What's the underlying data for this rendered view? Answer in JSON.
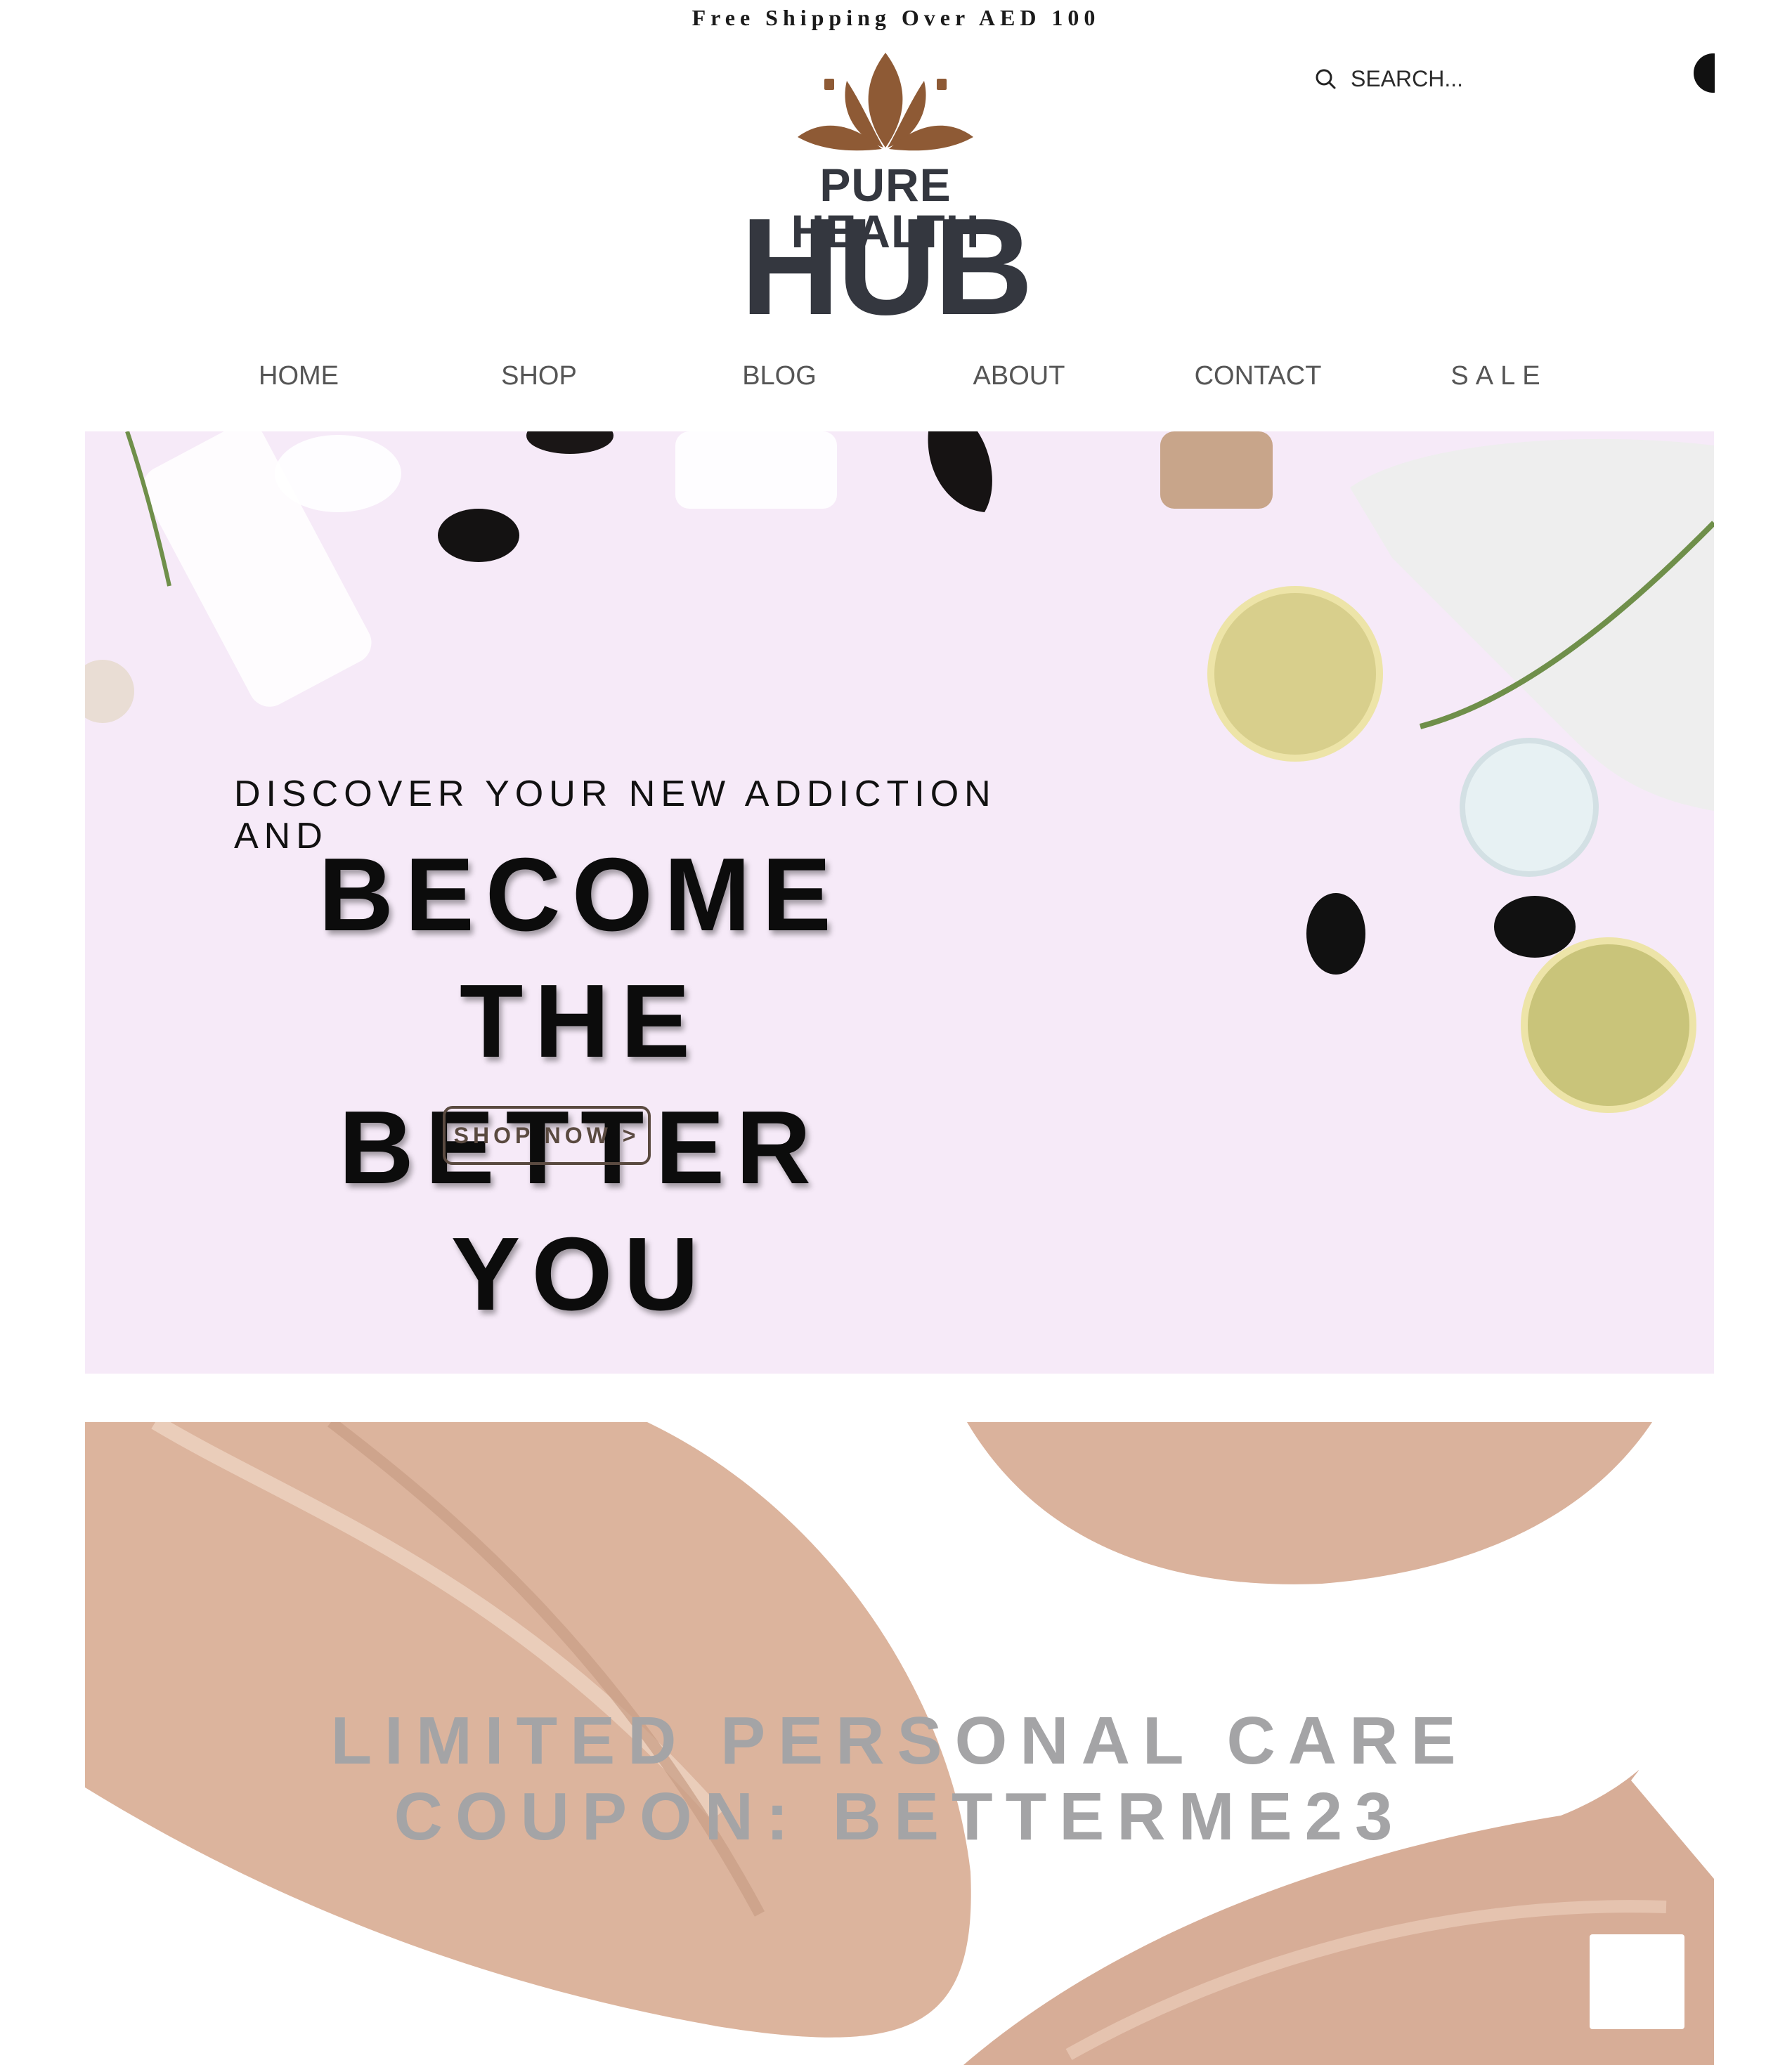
{
  "announcement": {
    "text": "Free Shipping Over AED 100"
  },
  "brand": {
    "line1": "PURE HEALTH",
    "line2": "HUB",
    "mark_icon": "lotus-icon",
    "mark_color": "#8e5a35",
    "text_color": "#34373f"
  },
  "search": {
    "icon": "search-icon",
    "label": "SEARCH..."
  },
  "nav": {
    "items": [
      {
        "label": "HOME"
      },
      {
        "label": "SHOP"
      },
      {
        "label": "BLOG"
      },
      {
        "label": "ABOUT"
      },
      {
        "label": "CONTACT"
      },
      {
        "label": "SALE"
      }
    ]
  },
  "hero": {
    "kicker": "DISCOVER YOUR NEW ADDICTION AND",
    "title_line1": "BECOME THE",
    "title_line2": "BETTER YOU",
    "cta": "SHOP NOW >",
    "background_color": "#f6eaf8"
  },
  "promo": {
    "line1": "LIMITED PERSONAL CARE",
    "line2": "COUPON: BETTERME23",
    "text_color": "#a4a4a6",
    "swatch_color": "#dcb49d"
  }
}
